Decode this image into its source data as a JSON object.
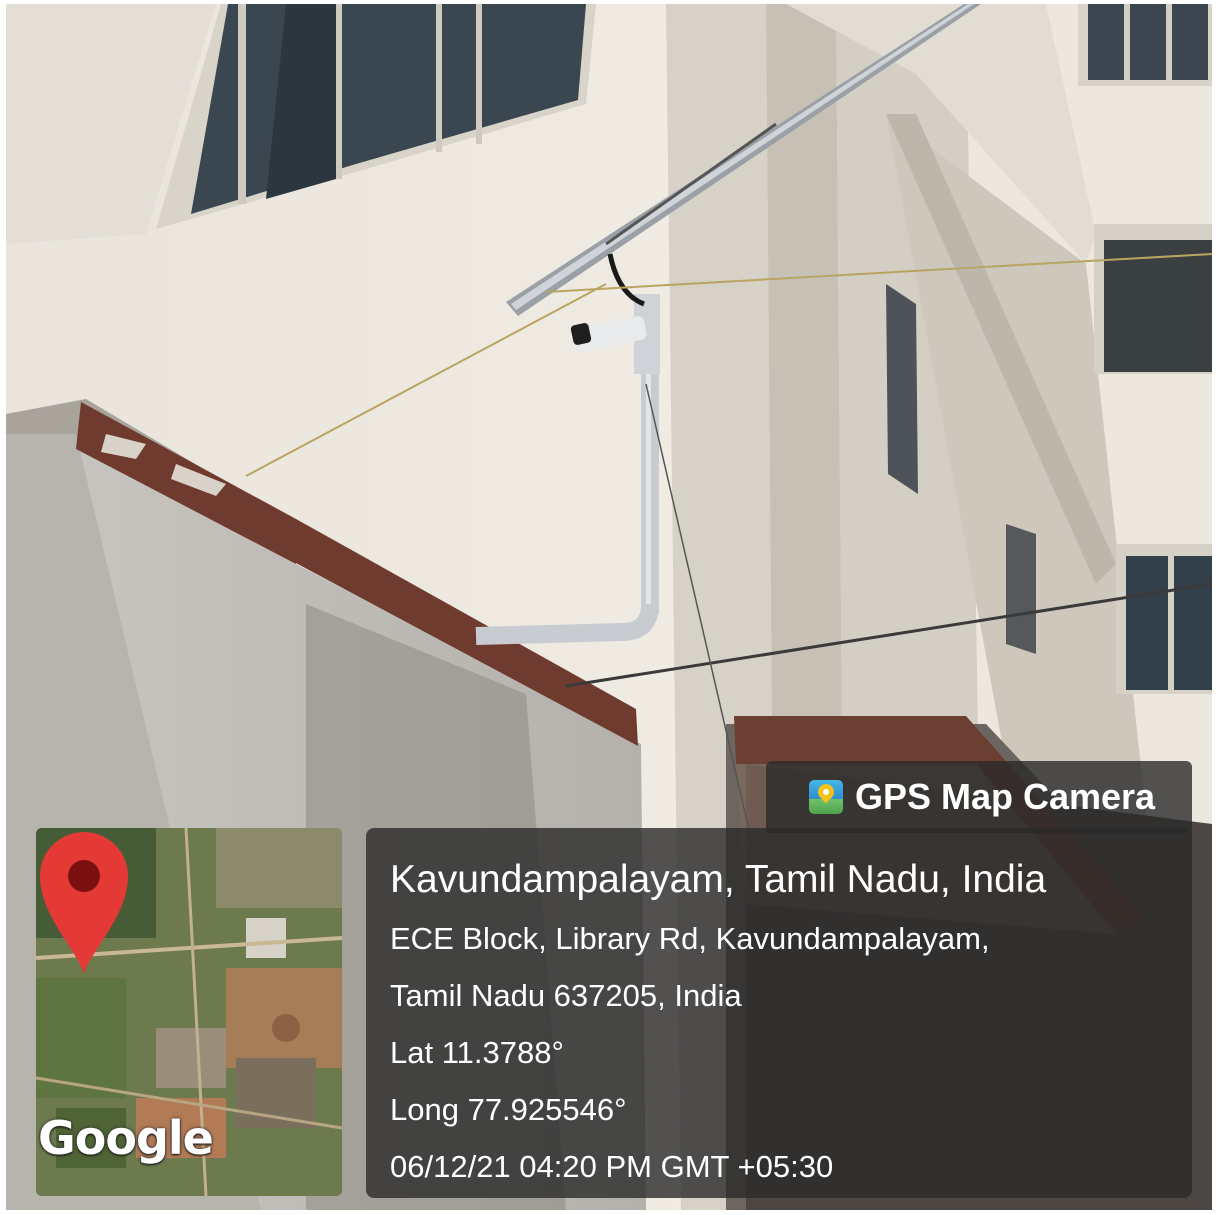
{
  "overlay": {
    "app_name": "GPS Map Camera",
    "app_icon": "gps-map-camera-icon",
    "location_title": "Kavundampalayam, Tamil Nadu, India",
    "address_line_1": "ECE Block, Library Rd, Kavundampalayam,",
    "address_line_2": "Tamil Nadu 637205, India",
    "latitude": "Lat 11.3788°",
    "longitude": "Long 77.925546°",
    "timestamp": "06/12/21 04:20 PM GMT +05:30"
  },
  "map_thumbnail": {
    "provider_logo": "Google",
    "marker_icon": "map-pin-icon",
    "marker_color": "#e53935"
  },
  "colors": {
    "panel_bg": "#2a2a2a",
    "panel_text": "#ffffff",
    "wall": "#ece8e0",
    "parapet_trim": "#6e3b2e"
  }
}
